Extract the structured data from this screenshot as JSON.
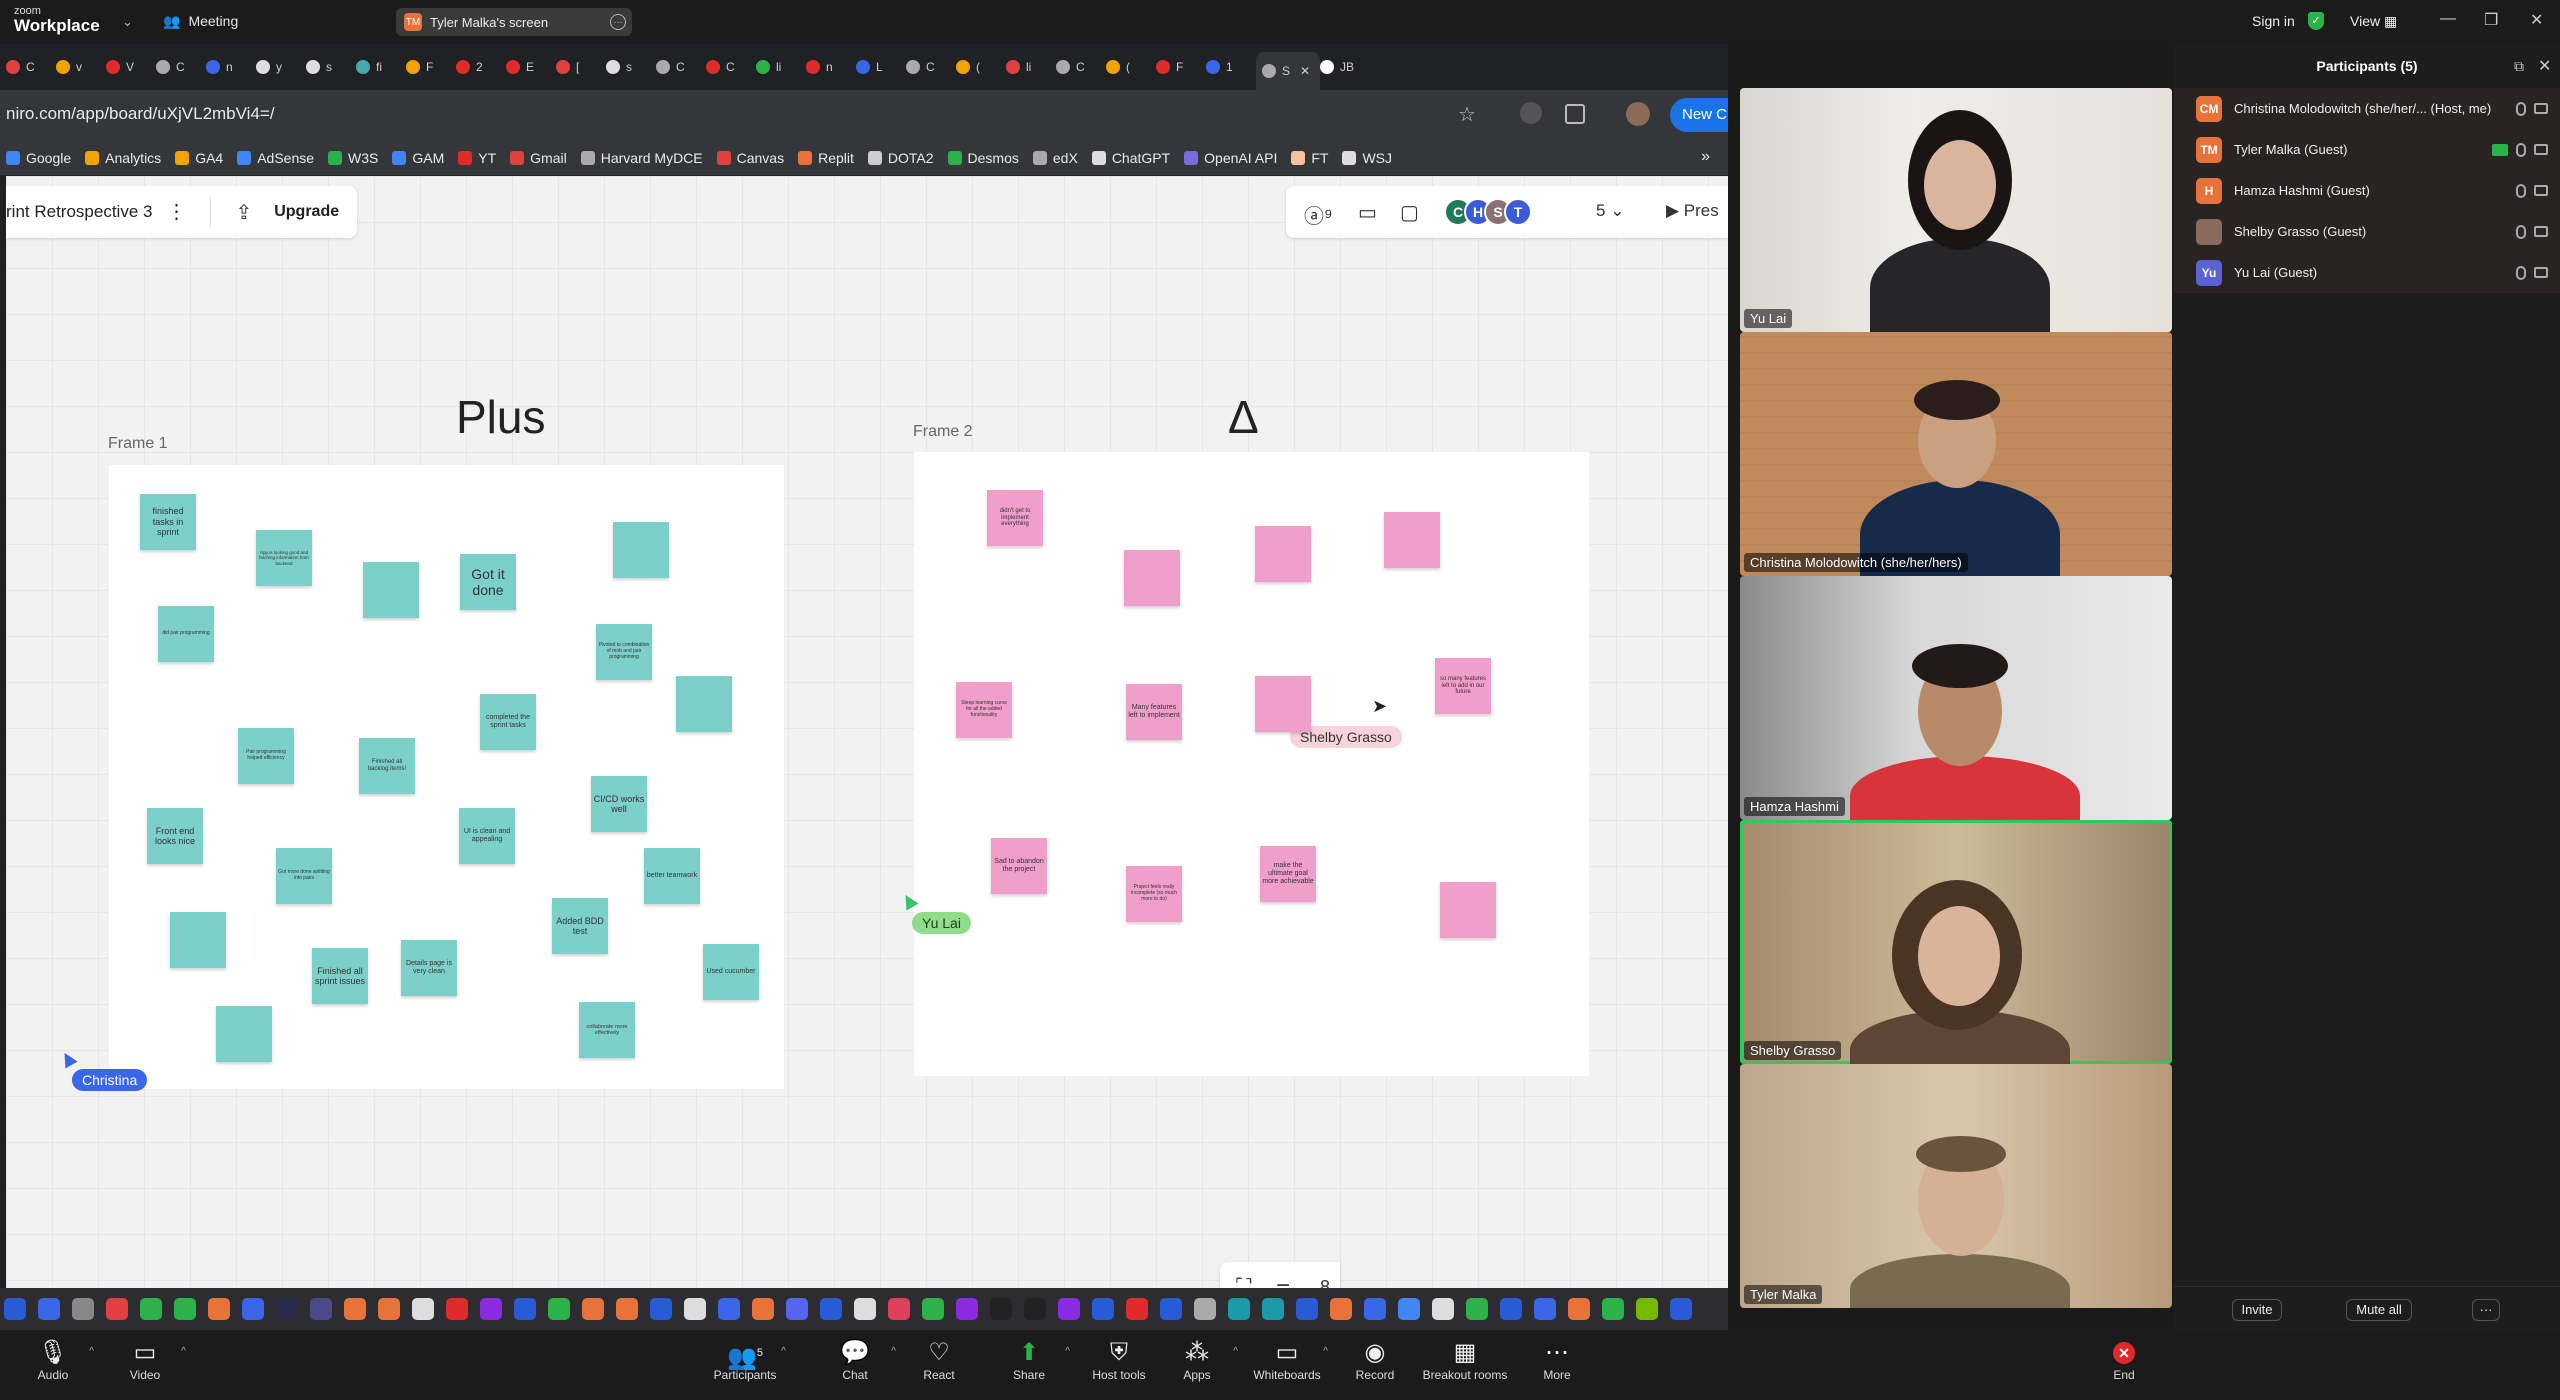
{
  "zoom": {
    "logo_top": "zoom",
    "logo_bottom": "Workplace",
    "meeting_label": "Meeting",
    "share_pill": "Tyler Malka's screen",
    "share_pill_initials": "TM",
    "sign_in": "Sign in",
    "view": "View"
  },
  "browser": {
    "url": "niro.com/app/board/uXjVL2mbVi4=/",
    "new_chat": "New C",
    "tabs": [
      "C",
      "v",
      "V",
      "C",
      "n",
      "y",
      "s",
      "fi",
      "F",
      "2",
      "E",
      "[",
      "s",
      "C",
      "C",
      "li",
      "n",
      "L",
      "C",
      "(",
      "li",
      "C",
      "(",
      "F",
      "1",
      "S",
      "JB"
    ],
    "bookmarks": [
      "Google",
      "Analytics",
      "GA4",
      "AdSense",
      "W3S",
      "GAM",
      "YT",
      "Gmail",
      "Harvard MyDCE",
      "Canvas",
      "Replit",
      "DOTA2",
      "Desmos",
      "edX",
      "ChatGPT",
      "OpenAI API",
      "FT",
      "WSJ"
    ]
  },
  "miro": {
    "board_title": "rint Retrospective 3",
    "upgrade": "Upgrade",
    "collab_count": "5",
    "present": "Pres",
    "avatars": [
      "C",
      "H",
      "S",
      "T"
    ],
    "frame1_label": "Frame 1",
    "frame2_label": "Frame 2",
    "plus_title": "Plus",
    "delta_title": "Δ",
    "zoom_partial": "8",
    "cursors": {
      "christina": "Christina",
      "yu": "Yu Lai",
      "shelby": "Shelby Grasso"
    },
    "plus_notes": [
      "finished tasks in sprint",
      "App is looking good and fetching information from backend",
      "",
      "Got it done",
      "",
      "did pair programming",
      "Pivoted to combination of mob and pair programming",
      "",
      "completed the sprint tasks",
      "Pair programming helped efficiency",
      "Finished all backlog items!",
      "CI/CD works well",
      "Front end looks nice",
      "UI is clean and appealing",
      "Got more done splitting into pairs",
      "better teamwork",
      "",
      "Added BDD test",
      "Finished all sprint issues",
      "Details page is very clean",
      "Used cucumber",
      "",
      "collaborate more effectively"
    ],
    "delta_notes": [
      "didn't get to implement everything",
      "",
      "",
      "",
      "Steep learning curve for all the added functionality",
      "Many features left to implement",
      "",
      "so many features left to add in our future",
      "Sad to abandon the project",
      "Project feels really incomplete (so much more to do)",
      "make the ultimate goal more achievable",
      ""
    ]
  },
  "participants": {
    "header": "Participants (5)",
    "list": [
      {
        "initials": "CM",
        "name": "Christina Molodowitch (she/her/... (Host, me)",
        "color": "#e8733a"
      },
      {
        "initials": "TM",
        "name": "Tyler Malka (Guest)",
        "color": "#e8733a"
      },
      {
        "initials": "H",
        "name": "Hamza Hashmi (Guest)",
        "color": "#e8733a"
      },
      {
        "initials": "",
        "name": "Shelby Grasso (Guest)",
        "color": "#8a6a5a"
      },
      {
        "initials": "Yu",
        "name": "Yu Lai (Guest)",
        "color": "#5b63d3"
      }
    ],
    "invite": "Invite",
    "mute_all": "Mute all",
    "more": "···"
  },
  "videos": [
    {
      "name": "Yu Lai"
    },
    {
      "name": "Christina Molodowitch (she/her/hers)"
    },
    {
      "name": "Hamza Hashmi"
    },
    {
      "name": "Shelby Grasso"
    },
    {
      "name": "Tyler Malka"
    }
  ],
  "controls": {
    "audio": "Audio",
    "video": "Video",
    "participants": "Participants",
    "participants_count": "5",
    "chat": "Chat",
    "react": "React",
    "share": "Share",
    "host_tools": "Host tools",
    "apps": "Apps",
    "whiteboards": "Whiteboards",
    "record": "Record",
    "breakout_rooms": "Breakout rooms",
    "more": "More",
    "end": "End"
  }
}
